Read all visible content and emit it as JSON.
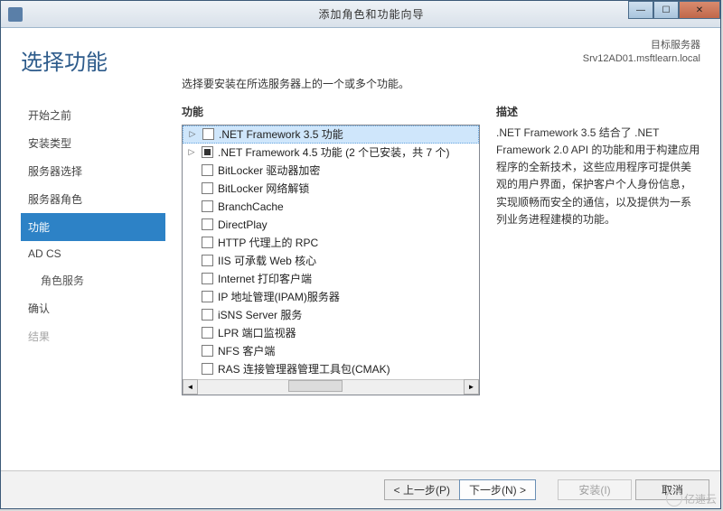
{
  "window": {
    "title": "添加角色和功能向导"
  },
  "page": {
    "title": "选择功能",
    "target_label": "目标服务器",
    "target_value": "Srv12AD01.msftlearn.local",
    "instruction": "选择要安装在所选服务器上的一个或多个功能。"
  },
  "steps": [
    {
      "label": "开始之前",
      "active": false,
      "disabled": false
    },
    {
      "label": "安装类型",
      "active": false,
      "disabled": false
    },
    {
      "label": "服务器选择",
      "active": false,
      "disabled": false
    },
    {
      "label": "服务器角色",
      "active": false,
      "disabled": false
    },
    {
      "label": "功能",
      "active": true,
      "disabled": false
    },
    {
      "label": "AD CS",
      "active": false,
      "disabled": false
    },
    {
      "label": "角色服务",
      "active": false,
      "disabled": false,
      "sub": true
    },
    {
      "label": "确认",
      "active": false,
      "disabled": false
    },
    {
      "label": "结果",
      "active": false,
      "disabled": true
    }
  ],
  "panes": {
    "features_heading": "功能",
    "description_heading": "描述",
    "description_text": ".NET Framework 3.5 结合了 .NET Framework 2.0 API 的功能和用于构建应用程序的全新技术，这些应用程序可提供美观的用户界面，保护客户个人身份信息，实现顺畅而安全的通信，以及提供为一系列业务进程建模的功能。"
  },
  "features": [
    {
      "label": ".NET Framework 3.5 功能",
      "expandable": true,
      "checked": false,
      "selected": true
    },
    {
      "label": ".NET Framework 4.5 功能 (2 个已安装，共 7 个)",
      "expandable": true,
      "checked": "indeterminate"
    },
    {
      "label": "BitLocker 驱动器加密",
      "expandable": false,
      "checked": false
    },
    {
      "label": "BitLocker 网络解锁",
      "expandable": false,
      "checked": false
    },
    {
      "label": "BranchCache",
      "expandable": false,
      "checked": false
    },
    {
      "label": "DirectPlay",
      "expandable": false,
      "checked": false
    },
    {
      "label": "HTTP 代理上的 RPC",
      "expandable": false,
      "checked": false
    },
    {
      "label": "IIS 可承载 Web 核心",
      "expandable": false,
      "checked": false
    },
    {
      "label": "Internet 打印客户端",
      "expandable": false,
      "checked": false
    },
    {
      "label": "IP 地址管理(IPAM)服务器",
      "expandable": false,
      "checked": false
    },
    {
      "label": "iSNS Server 服务",
      "expandable": false,
      "checked": false
    },
    {
      "label": "LPR 端口监视器",
      "expandable": false,
      "checked": false
    },
    {
      "label": "NFS 客户端",
      "expandable": false,
      "checked": false
    },
    {
      "label": "RAS 连接管理器管理工具包(CMAK)",
      "expandable": false,
      "checked": false
    }
  ],
  "buttons": {
    "prev": "< 上一步(P)",
    "next": "下一步(N) >",
    "install": "安装(I)",
    "cancel": "取消"
  },
  "watermark": "亿速云"
}
